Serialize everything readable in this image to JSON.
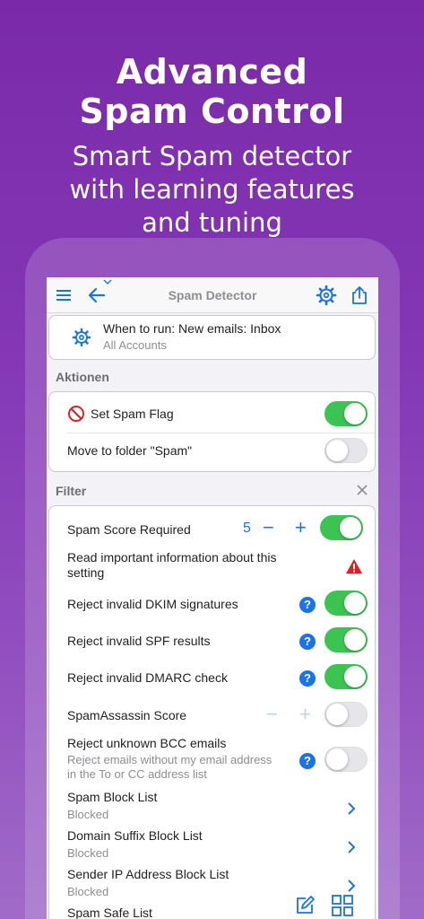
{
  "hero": {
    "title_line1": "Advanced",
    "title_line2": "Spam Control",
    "subtitle_line1": "Smart Spam detector",
    "subtitle_line2": "with learning features",
    "subtitle_line3": "and tuning"
  },
  "navbar": {
    "title": "Spam Detector",
    "icons": [
      "menu-icon",
      "back-arrow-icon",
      "chevron-down-icon",
      "gear-icon",
      "share-icon"
    ]
  },
  "trigger": {
    "title": "When to run: New emails: Inbox",
    "subtitle": "All Accounts"
  },
  "actions": {
    "header": "Aktionen",
    "items": [
      {
        "label": "Set Spam Flag",
        "enabled": true
      },
      {
        "label": "Move to folder \"Spam\"",
        "enabled": false
      }
    ]
  },
  "filter": {
    "header": "Filter",
    "spam_score": {
      "label": "Spam Score Required",
      "value": "5",
      "enabled": true
    },
    "important_info": "Read important information about this setting",
    "dkim": {
      "label": "Reject invalid DKIM signatures",
      "enabled": true
    },
    "spf": {
      "label": "Reject invalid SPF results",
      "enabled": true
    },
    "dmarc": {
      "label": "Reject invalid DMARC check",
      "enabled": true
    },
    "spamassassin": {
      "label": "SpamAssassin Score",
      "enabled": false
    },
    "bcc": {
      "label": "Reject unknown BCC emails",
      "sub": "Reject emails without my email address in the To or CC address list",
      "enabled": false
    },
    "lists": [
      {
        "label": "Spam Block List",
        "sub": "Blocked"
      },
      {
        "label": "Domain Suffix Block List",
        "sub": "Blocked"
      },
      {
        "label": "Sender IP Address Block List",
        "sub": "Blocked"
      },
      {
        "label": "Spam Safe List",
        "sub": ""
      }
    ]
  },
  "colors": {
    "accent": "#1a73e8",
    "toggle_on": "#3cc453",
    "warning": "#e02020",
    "forbidden": "#e02020"
  }
}
